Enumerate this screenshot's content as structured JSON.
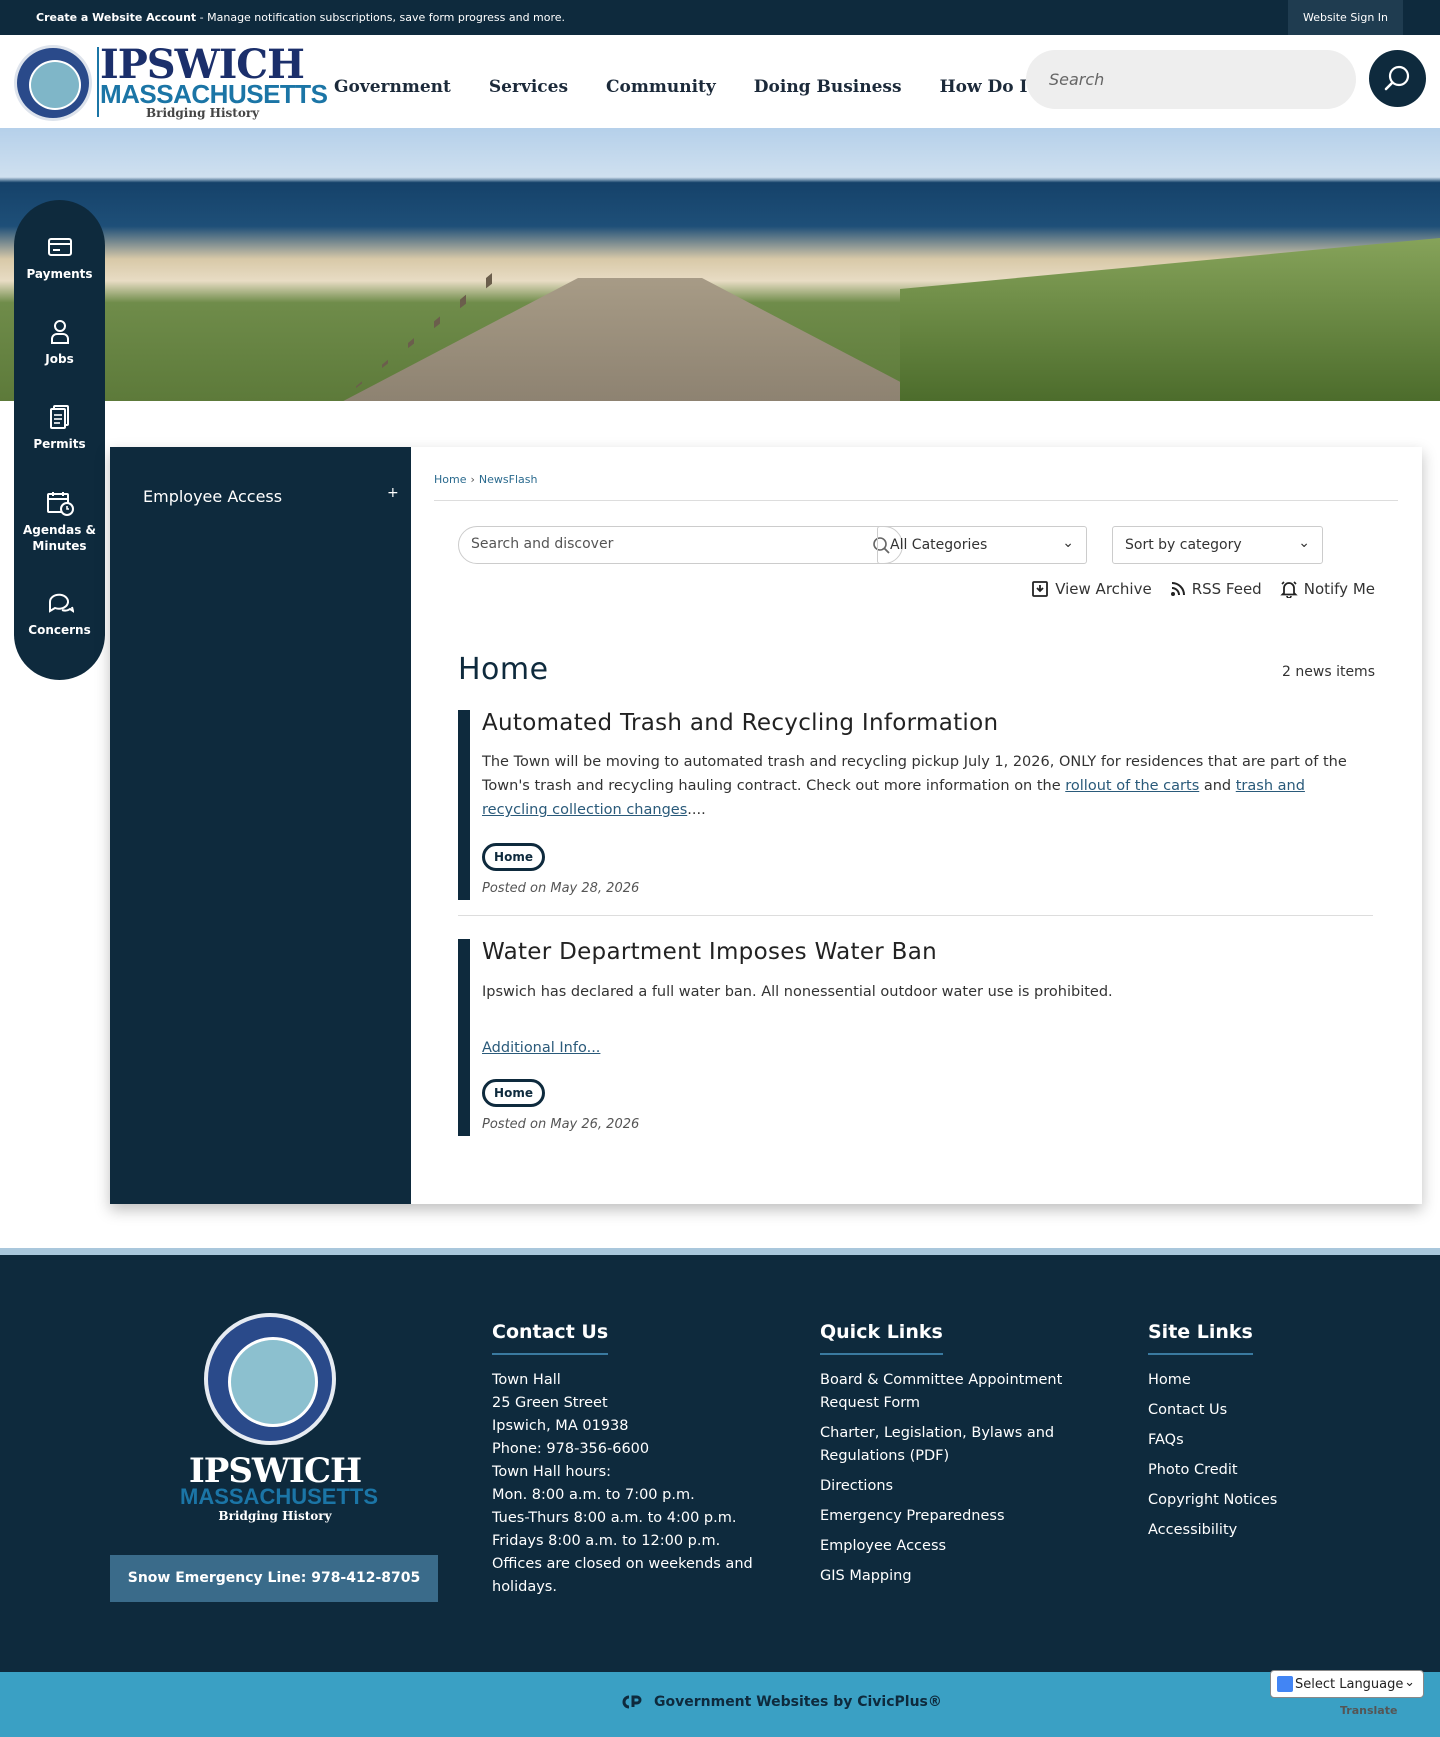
{
  "topbar": {
    "create_account": "Create a Website Account",
    "message": " - Manage notification subscriptions, save form progress and more.",
    "sign_in": "Website Sign In"
  },
  "header": {
    "logo_name": "IPSWICH",
    "logo_state": "MASSACHUSETTS",
    "logo_tagline": "Bridging History",
    "nav": [
      "Government",
      "Services",
      "Community",
      "Doing Business",
      "How Do I..."
    ],
    "search_placeholder": "Search"
  },
  "quick_links": [
    "Payments",
    "Jobs",
    "Permits",
    "Agendas & Minutes",
    "Concerns"
  ],
  "sidenav": {
    "item": "Employee Access",
    "expand": "+"
  },
  "breadcrumb": [
    "Home",
    "NewsFlash"
  ],
  "filters": {
    "search_placeholder": "Search and discover",
    "category": "All Categories",
    "sort": "Sort by category"
  },
  "actions": [
    "View Archive",
    "RSS Feed",
    "Notify Me"
  ],
  "section": {
    "title": "Home",
    "count": "2 news items"
  },
  "news": [
    {
      "title": "Automated Trash and Recycling Information",
      "body_start": "The Town will be moving to automated trash and recycling pickup July 1, 2026, ONLY for residences that are part of the Town's trash and recycling hauling contract. Check out more information on the ",
      "link1": "rollout of the carts",
      "body_mid": " and ",
      "link2": "trash and recycling collection changes",
      "body_end": "....",
      "tag": "Home",
      "posted": "Posted on May 28, 2026"
    },
    {
      "title": "Water Department Imposes Water Ban",
      "body": "Ipswich has declared a full water ban. All nonessential outdoor water use is prohibited.",
      "more": "Additional Info...",
      "tag": "Home",
      "posted": "Posted on May 26, 2026"
    }
  ],
  "footer": {
    "logo_name": "IPSWICH",
    "logo_state": "MASSACHUSETTS",
    "logo_tagline": "Bridging History",
    "snow": "Snow Emergency Line: 978-412-8705",
    "contact_title": "Contact Us",
    "contact_lines": [
      "Town Hall",
      "25 Green Street",
      "Ipswich, MA 01938",
      "Phone: 978-356-6600",
      "Town Hall hours:",
      "Mon. 8:00 a.m. to 7:00 p.m.",
      "Tues-Thurs 8:00 a.m. to 4:00 p.m.",
      "Fridays 8:00 a.m. to 12:00 p.m.",
      "Offices are closed on weekends and",
      "holidays."
    ],
    "quick_title": "Quick Links",
    "quick_links": [
      "Board & Committee Appointment Request Form",
      "Charter, Legislation, Bylaws and Regulations (PDF)",
      "Directions",
      "Emergency Preparedness",
      "Employee Access",
      "GIS Mapping"
    ],
    "site_title": "Site Links",
    "site_links": [
      "Home",
      "Contact Us",
      "FAQs",
      "Photo Credit",
      "Copyright Notices",
      "Accessibility"
    ],
    "gov": "Government Websites by CivicPlus®"
  },
  "translate": {
    "label": "Select Language",
    "powered": "Translate"
  },
  "colors": {
    "navy": "#0e2a3d",
    "accent": "#3aa0c4",
    "link": "#2a5a7a"
  }
}
